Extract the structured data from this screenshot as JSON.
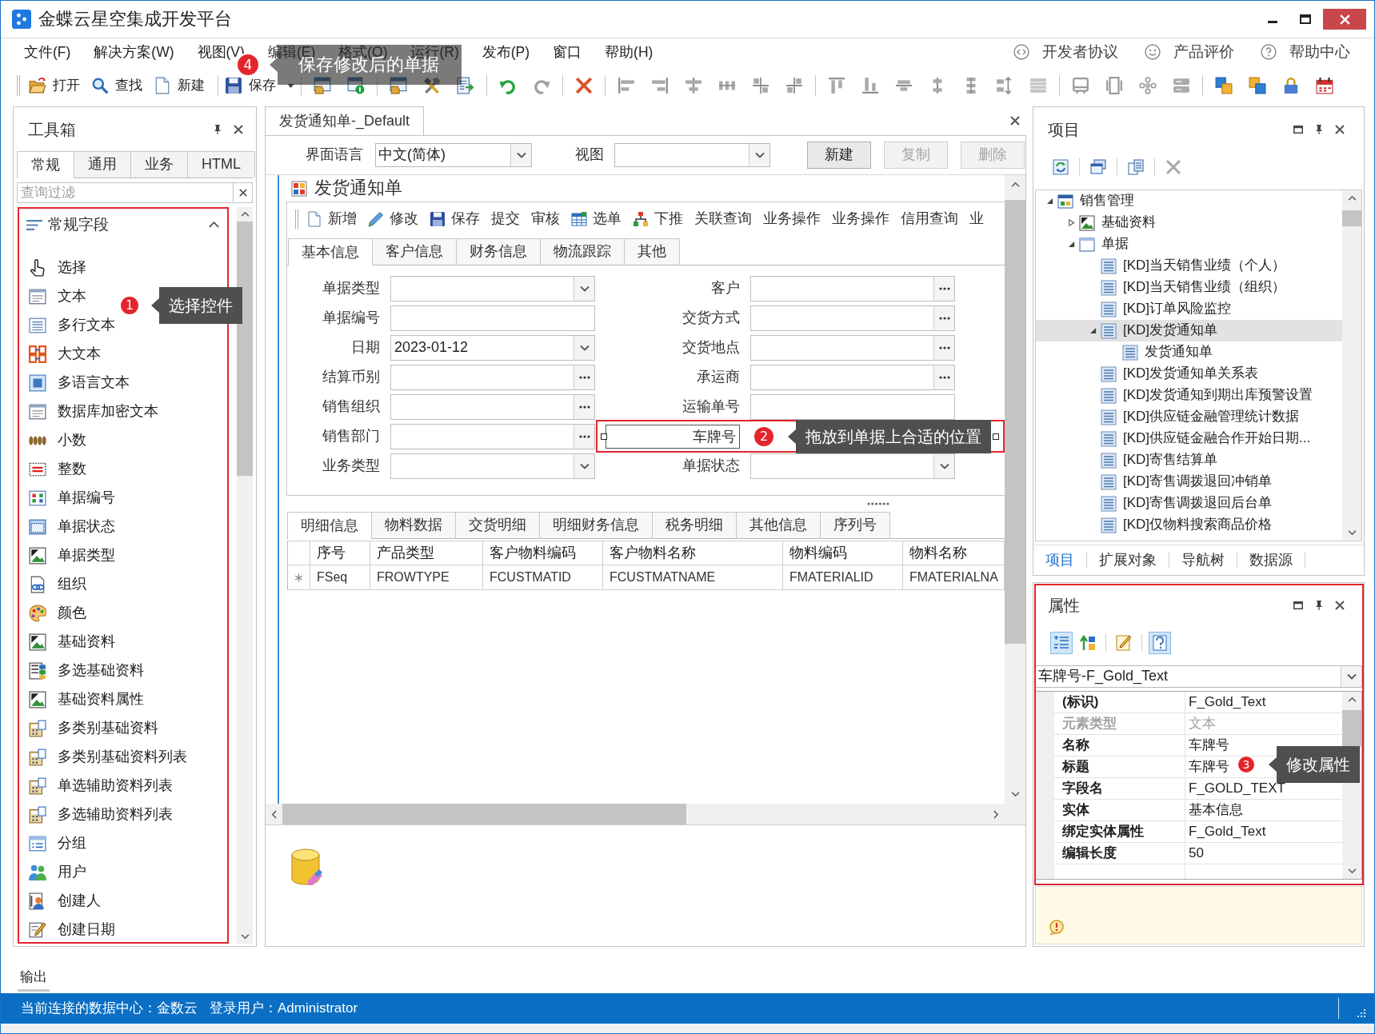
{
  "window": {
    "title": "金蝶云星空集成开发平台"
  },
  "menu": {
    "items": [
      "文件(F)",
      "解决方案(W)",
      "视图(V)",
      "编辑(E)",
      "格式(O)",
      "运行(R)",
      "发布(P)",
      "窗口",
      "帮助(H)"
    ],
    "links": [
      "开发者协议",
      "产品评价",
      "帮助中心"
    ]
  },
  "toolbar": {
    "buttons": [
      "打开",
      "查找",
      "新建",
      "保存"
    ],
    "callout": {
      "number": "4",
      "text": "保存修改后的单据"
    }
  },
  "toolbox": {
    "title": "工具箱",
    "tabs": [
      {
        "label": "常规",
        "selected": true
      },
      {
        "label": "通用",
        "selected": false
      },
      {
        "label": "业务",
        "selected": false
      },
      {
        "label": "HTML",
        "selected": false
      }
    ],
    "filter": {
      "placeholder": "查询过滤"
    },
    "group": {
      "title": "常规字段",
      "expanded": true
    },
    "items": [
      "选择",
      "文本",
      "多行文本",
      "大文本",
      "多语言文本",
      "数据库加密文本",
      "小数",
      "整数",
      "单据编号",
      "单据状态",
      "单据类型",
      "组织",
      "颜色",
      "基础资料",
      "多选基础资料",
      "基础资料属性",
      "多类别基础资料",
      "多类别基础资料列表",
      "单选辅助资料列表",
      "多选辅助资料列表",
      "分组",
      "用户",
      "创建人",
      "创建日期"
    ],
    "callout": {
      "number": "1",
      "text": "选择控件"
    }
  },
  "document_tabs": [
    {
      "label": "发货通知单-_Default",
      "selected": true
    }
  ],
  "view_bar": {
    "language_label": "界面语言",
    "language": "中文(简体)",
    "view_label": "视图",
    "buttons": [
      {
        "label": "新建",
        "disabled": false
      },
      {
        "label": "复制",
        "disabled": true
      },
      {
        "label": "删除",
        "disabled": true
      }
    ]
  },
  "bill": {
    "title": "发货通知单",
    "toolbar": [
      "新增",
      "修改",
      "保存",
      "提交",
      "审核",
      "选单",
      "下推",
      "关联查询",
      "业务操作",
      "业务操作",
      "信用查询",
      "业"
    ],
    "tabs": [
      {
        "label": "基本信息",
        "selected": true
      },
      {
        "label": "客户信息",
        "selected": false
      },
      {
        "label": "财务信息",
        "selected": false
      },
      {
        "label": "物流跟踪",
        "selected": false
      },
      {
        "label": "其他",
        "selected": false
      }
    ],
    "fields_left": [
      {
        "label": "单据类型",
        "kind": "dropdown",
        "selected": false
      },
      {
        "label": "单据编号",
        "kind": "text",
        "selected": false
      },
      {
        "label": "日期",
        "kind": "dropdown",
        "value": "2023-01-12",
        "selected": false
      },
      {
        "label": "结算币别",
        "kind": "lookup",
        "selected": false
      },
      {
        "label": "销售组织",
        "kind": "lookup",
        "selected": false
      },
      {
        "label": "销售部门",
        "kind": "lookup",
        "selected": false
      },
      {
        "label": "业务类型",
        "kind": "dropdown",
        "selected": false
      }
    ],
    "fields_right": [
      {
        "label": "客户",
        "kind": "lookup",
        "selected": false
      },
      {
        "label": "交货方式",
        "kind": "lookup",
        "selected": false
      },
      {
        "label": "交货地点",
        "kind": "lookup",
        "selected": false
      },
      {
        "label": "承运商",
        "kind": "lookup",
        "selected": false
      },
      {
        "label": "运输单号",
        "kind": "text",
        "selected": false
      },
      {
        "label": "车牌号",
        "kind": "label",
        "selected": true
      },
      {
        "label": "单据状态",
        "kind": "dropdown",
        "selected": false
      }
    ],
    "callout": {
      "number": "2",
      "text": "拖放到单据上合适的位置"
    },
    "detail_tabs": [
      {
        "label": "明细信息",
        "selected": true
      },
      {
        "label": "物料数据",
        "selected": false
      },
      {
        "label": "交货明细",
        "selected": false
      },
      {
        "label": "明细财务信息",
        "selected": false
      },
      {
        "label": "税务明细",
        "selected": false
      },
      {
        "label": "其他信息",
        "selected": false
      },
      {
        "label": "序列号",
        "selected": false
      }
    ],
    "grid": {
      "columns": [
        "序号",
        "产品类型",
        "客户物料编码",
        "客户物料名称",
        "物料编码",
        "物料名称"
      ],
      "rows": [
        [
          "FSeq",
          "FROWTYPE",
          "FCUSTMATID",
          "FCUSTMATNAME",
          "FMATERIALID",
          "FMATERIALNA"
        ]
      ]
    }
  },
  "project": {
    "title": "项目",
    "tree": [
      {
        "label": "销售管理",
        "expanded": true,
        "selected": false,
        "children": [
          {
            "label": "基础资料",
            "expanded": false,
            "selected": false
          },
          {
            "label": "单据",
            "expanded": true,
            "selected": false,
            "children": [
              {
                "label": "[KD]当天销售业绩（个人）",
                "selected": false
              },
              {
                "label": "[KD]当天销售业绩（组织）",
                "selected": false
              },
              {
                "label": "[KD]订单风险监控",
                "selected": false
              },
              {
                "label": "[KD]发货通知单",
                "expanded": true,
                "selected": true,
                "children": [
                  {
                    "label": "发货通知单",
                    "selected": false
                  }
                ]
              },
              {
                "label": "[KD]发货通知单关系表",
                "selected": false
              },
              {
                "label": "[KD]发货通知到期出库预警设置",
                "selected": false
              },
              {
                "label": "[KD]供应链金融管理统计数据",
                "selected": false
              },
              {
                "label": "[KD]供应链金融合作开始日期...",
                "selected": false
              },
              {
                "label": "[KD]寄售结算单",
                "selected": false
              },
              {
                "label": "[KD]寄售调拨退回冲销单",
                "selected": false
              },
              {
                "label": "[KD]寄售调拨退回后台单",
                "selected": false
              },
              {
                "label": "[KD]仅物料搜索商品价格",
                "selected": false
              }
            ]
          }
        ]
      }
    ],
    "tabs": [
      {
        "label": "项目",
        "selected": true
      },
      {
        "label": "扩展对象",
        "selected": false
      },
      {
        "label": "导航树",
        "selected": false
      },
      {
        "label": "数据源",
        "selected": false
      }
    ]
  },
  "properties": {
    "title": "属性",
    "toolbar": [
      {
        "on": true
      },
      {
        "on": false
      },
      {
        "on": false
      },
      {
        "on": true
      }
    ],
    "object": "车牌号-F_Gold_Text",
    "rows": [
      {
        "name": "(标识)",
        "value": "F_Gold_Text",
        "disabled": false
      },
      {
        "name": "元素类型",
        "value": "文本",
        "disabled": true
      },
      {
        "name": "名称",
        "value": "车牌号",
        "disabled": false
      },
      {
        "name": "标题",
        "value": "车牌号",
        "disabled": false
      },
      {
        "name": "字段名",
        "value": "F_GOLD_TEXT",
        "disabled": false
      },
      {
        "name": "实体",
        "value": "基本信息",
        "disabled": false
      },
      {
        "name": "绑定实体属性",
        "value": "F_Gold_Text",
        "disabled": false
      },
      {
        "name": "编辑长度",
        "value": "50",
        "disabled": false
      }
    ],
    "callout": {
      "number": "3",
      "text": "修改属性"
    }
  },
  "output": {
    "label": "输出"
  },
  "status_bar": [
    "当前连接的数据中心：金数云",
    "登录用户：Administrator"
  ]
}
